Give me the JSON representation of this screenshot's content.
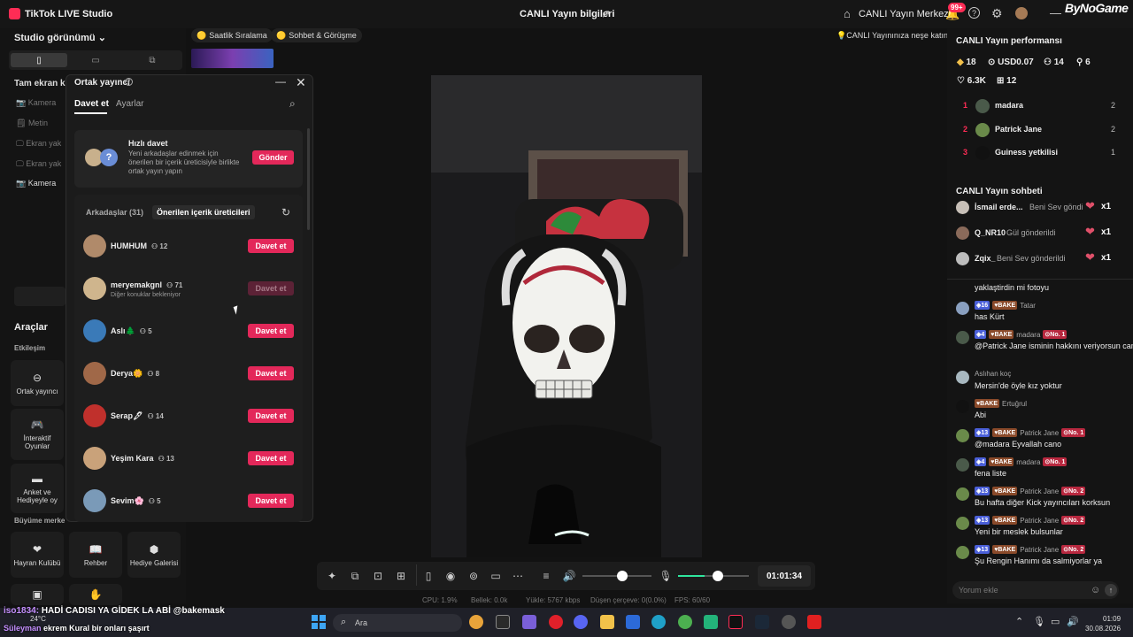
{
  "titlebar": {
    "app_name": "TikTok LIVE Studio",
    "window_title": "CANLI Yayın bilgileri",
    "live_center": "CANLI Yayın Merkezi",
    "notif_count": "99+",
    "brand": "ByNoGame"
  },
  "left": {
    "studio_view": "Studio görünümü",
    "section_fullscreen": "Tam ekran ka",
    "sources": [
      {
        "label": "Kamera"
      },
      {
        "label": "Metin"
      },
      {
        "label": "Ekran yak"
      },
      {
        "label": "Ekran yak"
      },
      {
        "label": "Kamera"
      }
    ],
    "tools_title": "Araçlar",
    "engagement": "Etkileşim",
    "growth": "Büyüme merke",
    "tiles": {
      "cohost": "Ortak yayıncı",
      "games": "İnteraktif Oyunlar",
      "poll": "Anket ve Hediyeyle oy",
      "fanclub": "Hayran Kulübü",
      "guide": "Rehber",
      "gallery": "Hediye Galerisi"
    }
  },
  "pills": {
    "hourly": "Saatlik Sıralama",
    "chat": "Sohbet & Görüşme"
  },
  "tip": "CANLI Yayınınıza neşe katın",
  "modal": {
    "title": "Ortak yayıncı",
    "tabs": [
      "Davet et",
      "Ayarlar"
    ],
    "quick": {
      "title": "Hızlı davet",
      "desc": "Yeni arkadaşlar edinmek için önerilen bir içerik üreticisiyle birlikte ortak yayın yapın",
      "button": "Gönder"
    },
    "list_tabs": [
      "Arkadaşlar (31)",
      "Önerilen içerik üreticileri"
    ],
    "invite_label": "Davet et",
    "friends": [
      {
        "name": "HUMHUM",
        "count": "12",
        "sub": "",
        "color": "#b08a6a",
        "disabled": false
      },
      {
        "name": "meryemakgnl",
        "count": "71",
        "sub": "Diğer konuklar bekleniyor",
        "color": "#cfb58d",
        "disabled": true
      },
      {
        "name": "Aslı🌲",
        "count": "5",
        "sub": "",
        "color": "#3a7ab8",
        "disabled": false
      },
      {
        "name": "Derya🌼",
        "count": "8",
        "sub": "",
        "color": "#a06848",
        "disabled": false
      },
      {
        "name": "Serap🖋",
        "count": "14",
        "sub": "",
        "color": "#c0302c",
        "disabled": false
      },
      {
        "name": "Yeşim Kara",
        "count": "13",
        "sub": "",
        "color": "#c9a27a",
        "disabled": false
      },
      {
        "name": "Sevim🌸",
        "count": "5",
        "sub": "",
        "color": "#7a9ab8",
        "disabled": false
      }
    ]
  },
  "controls": {
    "timer": "01:01:34"
  },
  "stats": {
    "cpu": "CPU: 1.9%",
    "mem": "Bellek: 0.0k",
    "upload": "Yükle: 5767 kbps",
    "dropped": "Düşen çerçeve: 0(0.0%)",
    "fps": "FPS: 60/60"
  },
  "right": {
    "perf_title": "CANLI Yayın performansı",
    "stats": [
      {
        "icon": "diamond-icon",
        "value": "18"
      },
      {
        "icon": "coin-icon",
        "value": "USD0.07"
      },
      {
        "icon": "users-icon",
        "value": "14"
      },
      {
        "icon": "plus-user-icon",
        "value": "6"
      },
      {
        "icon": "heart-icon",
        "value": "6.3K"
      },
      {
        "icon": "gift-icon",
        "value": "12"
      }
    ],
    "ranking": [
      {
        "rank": "1",
        "name": "madara",
        "value": "2",
        "color": "#4a5a4a"
      },
      {
        "rank": "2",
        "name": "Patrick Jane",
        "value": "2",
        "color": "#6a8a4a"
      },
      {
        "rank": "3",
        "name": "Guiness yetkilisi",
        "value": "1",
        "color": "#111111"
      }
    ],
    "chat_title": "CANLI Yayın sohbeti",
    "gifts": [
      {
        "name": "İsmail erde...",
        "text": "Beni Sev göndi",
        "count": "x1",
        "color": "#c8c0b8"
      },
      {
        "name": "Q_NR10",
        "text": "Gül gönderildi",
        "count": "x1",
        "color": "#8a6a5a"
      },
      {
        "name": "Zqix_",
        "text": "Beni Sev gönderildi",
        "count": "x1",
        "color": "#bdbdbd"
      }
    ],
    "messages": [
      {
        "level": "",
        "fan": "",
        "user": "",
        "rank": "",
        "text": "yaklaştirdin mi fotoyu",
        "color": ""
      },
      {
        "level": "16",
        "fan": "BAKE",
        "user": "Tatar",
        "rank": "",
        "text": "has Kürt",
        "color": "#8aa0c0"
      },
      {
        "level": "4",
        "fan": "BAKE",
        "user": "madara",
        "rank": "No. 1",
        "text": "@Patrick Jane isminin hakkını veriyorsun cano",
        "color": "#4a5a4a"
      },
      {
        "level": "",
        "fan": "",
        "user": "Aslıhan koç",
        "rank": "",
        "text": "Mersin'de öyle kız yoktur",
        "color": "#a8b8c0"
      },
      {
        "level": "",
        "fan": "BAKE",
        "user": "Ertuğrul",
        "rank": "",
        "text": "Abi",
        "color": "#111111"
      },
      {
        "level": "13",
        "fan": "BAKE",
        "user": "Patrick Jane",
        "rank": "No. 1",
        "text": "@madara Eyvallah cano",
        "color": "#6a8a4a"
      },
      {
        "level": "4",
        "fan": "BAKE",
        "user": "madara",
        "rank": "No. 1",
        "text": "fena liste",
        "color": "#4a5a4a"
      },
      {
        "level": "13",
        "fan": "BAKE",
        "user": "Patrick Jane",
        "rank": "No. 2",
        "text": "Bu hafta diğer Kick yayıncıları korksun",
        "color": "#6a8a4a"
      },
      {
        "level": "13",
        "fan": "BAKE",
        "user": "Patrick Jane",
        "rank": "No. 2",
        "text": "Yeni bir meslek bulsunlar",
        "color": "#6a8a4a"
      },
      {
        "level": "13",
        "fan": "BAKE",
        "user": "Patrick Jane",
        "rank": "No. 2",
        "text": "Şu Rengin Hanımı da salmiyorlar ya",
        "color": "#6a8a4a"
      }
    ],
    "comment_placeholder": "Yorum ekle"
  },
  "ticker": {
    "user": "iso1834:",
    "line1": "HADİ CADISI YA GİDEK LA ABİ @bakemask",
    "user2": "Süleyman",
    "line2": "ekrem Kural bir onları şaşırt"
  },
  "taskbar": {
    "weather": "24°C",
    "search": "Ara",
    "time": "01:09",
    "date": "30.08.2026"
  }
}
